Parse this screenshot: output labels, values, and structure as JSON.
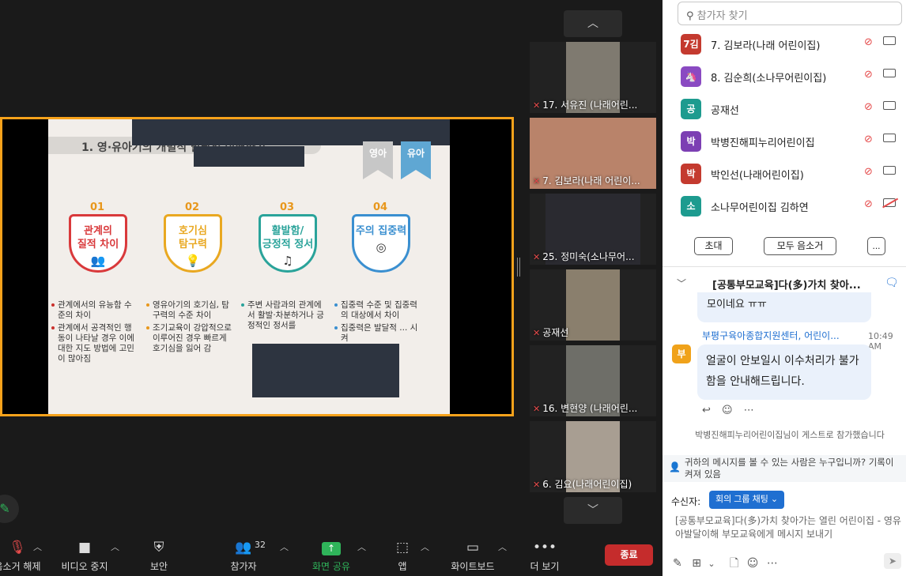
{
  "slide": {
    "title": "1. 영·유아기의 개별적 발달적 이해하기",
    "ribbons": [
      {
        "label": "영아",
        "color": "#c7c7c7"
      },
      {
        "label": "유아",
        "color": "#5fa7d3"
      }
    ],
    "items": [
      {
        "num": "01",
        "title": "관계의\n질적 차이",
        "color": "#d9393b",
        "icon": "👥",
        "bullets": [
          "관계에서의 유능함 수준의 차이",
          "관계에서 공격적인 행동이 나타날 경우 이에 대한 지도 방법에 고민이 많아짐"
        ]
      },
      {
        "num": "02",
        "title": "호기심\n탐구력",
        "color": "#e9a821",
        "icon": "💡",
        "bullets": [
          "영유아기의 호기심, 탐구력의 수준 차이",
          "조기교육이 강압적으로 이루어진 경우 빠르게 호기심을 잃어 감"
        ]
      },
      {
        "num": "03",
        "title": "활발함/\n긍정적 정서",
        "color": "#2aa39a",
        "icon": "♫",
        "bullets": [
          "주변 사람과의 관계에서 활발·차분하거나 긍정적인 정서를"
        ]
      },
      {
        "num": "04",
        "title": "주의 집중력",
        "color": "#3a8fd0",
        "icon": "◎",
        "bullets": [
          "집중력 수준 및 집중력의 대상에서 차이",
          "집중력은 발달적 ... 시켜"
        ]
      }
    ]
  },
  "thumbnails": [
    {
      "label": "17. 서유진 (나래어린...",
      "bg": "#7f7a70"
    },
    {
      "label": "7. 김보라(나래 어린이...",
      "bg": "#b9836a"
    },
    {
      "label": "25. 정미숙(소나무어...",
      "bg": "#2a2a30"
    },
    {
      "label": "공재선",
      "bg": "#8a7f6d"
    },
    {
      "label": "16. 변현양 (나래어린...",
      "bg": "#6e6e68"
    },
    {
      "label": "6. 김요(나래어린이집)",
      "bg": "#a89e92"
    }
  ],
  "toolbar": {
    "mute": "음소거 해제",
    "video": "비디오 중지",
    "security": "보안",
    "participants": "참가자",
    "participants_count": "32",
    "share": "화면 공유",
    "apps": "앱",
    "whiteboard": "화이트보드",
    "more": "더 보기",
    "end": "종료"
  },
  "participants_panel": {
    "search_placeholder": "참가자 찾기",
    "list": [
      {
        "avatar": "7김",
        "name": "7. 김보라(나래 어린이집)",
        "color": "#c43a2f",
        "cam_off": false
      },
      {
        "avatar": "🦄",
        "name": "8. 김순희(소나무어린이집)",
        "color": "#8a4ac2",
        "cam_off": false
      },
      {
        "avatar": "공",
        "name": "공재선",
        "color": "#1d9b8f",
        "cam_off": false
      },
      {
        "avatar": "박",
        "name": "박병진해피누리어린이집",
        "color": "#7c3fb3",
        "cam_off": false
      },
      {
        "avatar": "박",
        "name": "박인선(나래어린이집)",
        "color": "#c43a2f",
        "cam_off": false
      },
      {
        "avatar": "소",
        "name": "소나무어린이집 김하연",
        "color": "#1d9b8f",
        "cam_off": true
      }
    ],
    "invite": "초대",
    "mute_all": "모두 음소거",
    "more": "..."
  },
  "chat": {
    "title": "[공통부모교육]다(多)가치 찾아...",
    "prev_bubble": "모이네요 ㅠㅠ",
    "sender": "부평구육아종합지원센터, 어린이...",
    "time": "10:49 AM",
    "sender_avatar": "부",
    "message": "얼굴이 안보일시 이수처리가 불가함을 안내해드립니다.",
    "system": "박병진해피누리어린이집님이 게스트로 참가했습니다",
    "notice": "귀하의 메시지를 볼 수 있는 사람은 누구입니까? 기록이 켜져 있음",
    "to_label": "수신자:",
    "to_value": "회의 그룹 채팅",
    "input_placeholder": "[공통부모교육]다(多)가치 찾아가는 열린 어린이집 - 영유아발달이해 부모교육에게 메시지 보내기"
  }
}
